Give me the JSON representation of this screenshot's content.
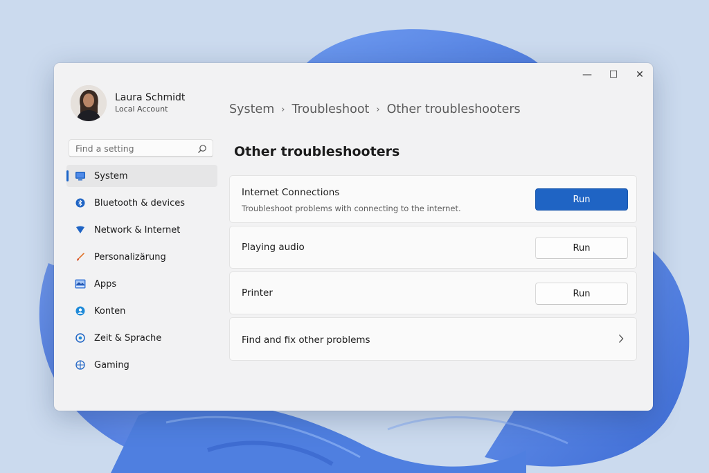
{
  "window": {
    "controls": {
      "minimize": "—",
      "maximize": "☐",
      "close": "✕"
    }
  },
  "profile": {
    "name": "Laura Schmidt",
    "account_type": "Local Account"
  },
  "search": {
    "placeholder": "Find a setting",
    "icon": "search-icon"
  },
  "sidebar": {
    "items": [
      {
        "label": "System",
        "icon": "system-icon",
        "active": true
      },
      {
        "label": "Bluetooth & devices",
        "icon": "bluetooth-icon"
      },
      {
        "label": "Network & Internet",
        "icon": "network-icon"
      },
      {
        "label": "Personalizärung",
        "icon": "brush-icon"
      },
      {
        "label": "Apps",
        "icon": "apps-icon"
      },
      {
        "label": "Konten",
        "icon": "accounts-icon"
      },
      {
        "label": "Zeit & Sprache",
        "icon": "time-language-icon"
      },
      {
        "label": "Gaming",
        "icon": "gaming-icon"
      }
    ]
  },
  "breadcrumb": {
    "items": [
      "System",
      "Troubleshoot",
      "Other troubleshooters"
    ],
    "separator": "›"
  },
  "page": {
    "title": "Other troubleshooters"
  },
  "troubleshooters": [
    {
      "title": "Internet Connections",
      "description": "Troubleshoot problems with connecting to the internet.",
      "button": "Run",
      "primary": true
    },
    {
      "title": "Playing audio",
      "button": "Run"
    },
    {
      "title": "Printer",
      "button": "Run"
    },
    {
      "title": "Find and fix other problems",
      "icon": "chevron-right-icon"
    }
  ],
  "colors": {
    "accent": "#1f64c4",
    "window_bg": "#f2f2f3",
    "card_bg": "#fafafa",
    "wallpaper": "#c9d9ef",
    "bloom": "#5a86dc"
  }
}
